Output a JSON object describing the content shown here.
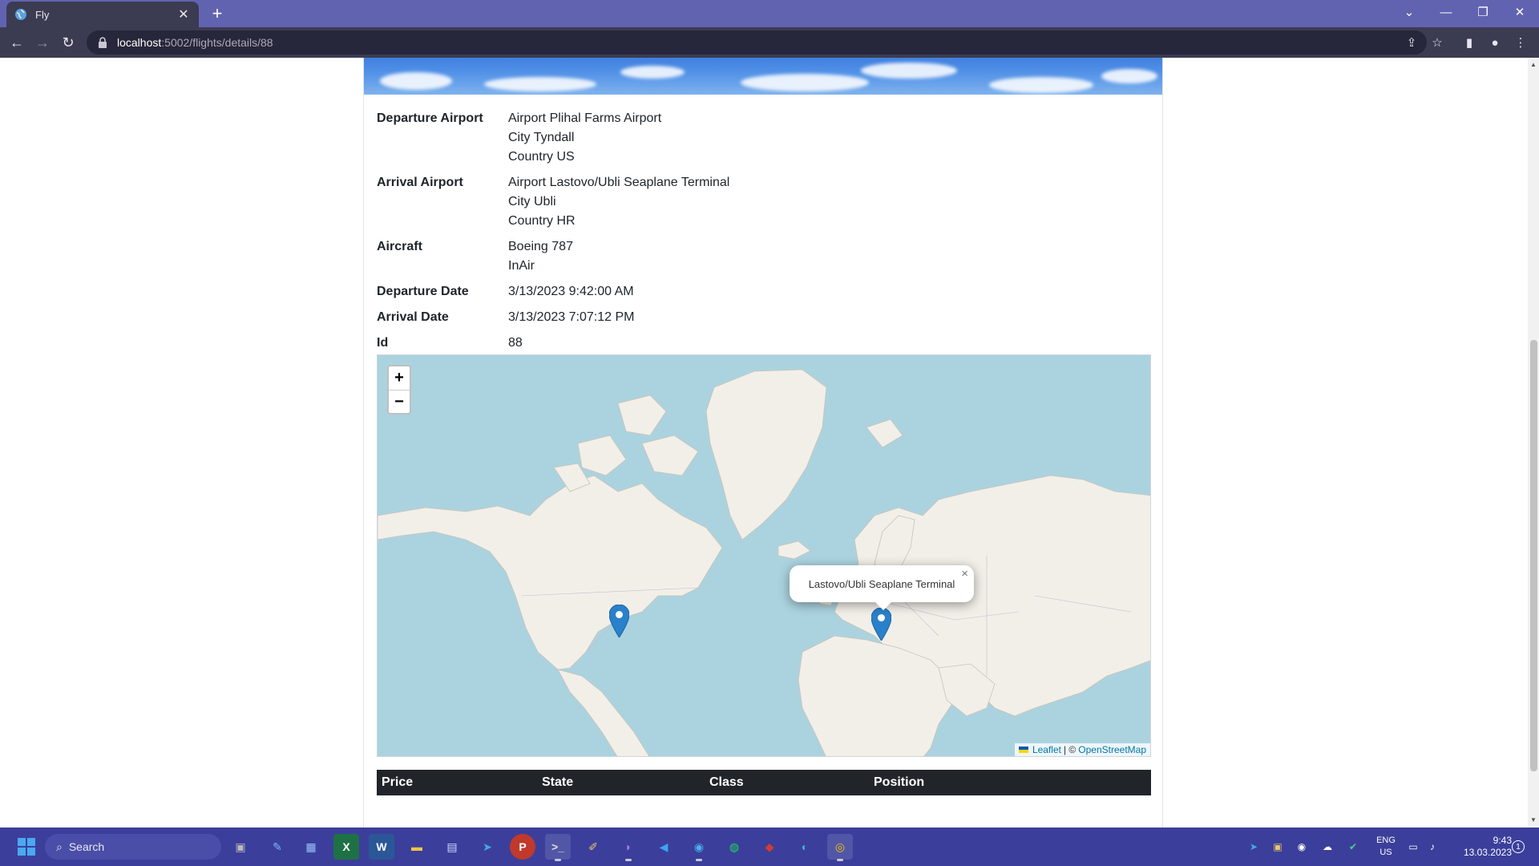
{
  "browser": {
    "tab_title": "Fly",
    "url_host": "localhost",
    "url_path": ":5002/flights/details/88"
  },
  "details": [
    {
      "label": "Departure Airport",
      "lines": [
        "Airport Plihal Farms Airport",
        "City Tyndall",
        "Country US"
      ]
    },
    {
      "label": "Arrival Airport",
      "lines": [
        "Airport Lastovo/Ubli Seaplane Terminal",
        "City Ubli",
        "Country HR"
      ]
    },
    {
      "label": "Aircraft",
      "lines": [
        "Boeing 787",
        "InAir"
      ]
    },
    {
      "label": "Departure Date",
      "lines": [
        "3/13/2023 9:42:00 AM"
      ]
    },
    {
      "label": "Arrival Date",
      "lines": [
        "3/13/2023 7:07:12 PM"
      ]
    },
    {
      "label": "Id",
      "lines": [
        "88"
      ]
    }
  ],
  "map": {
    "zoom_in": "+",
    "zoom_out": "−",
    "popup_text": "Lastovo/Ubli Seaplane Terminal",
    "popup_close": "×",
    "attribution_leaflet": "Leaflet",
    "attribution_sep": "| ©",
    "attribution_osm": "OpenStreetMap",
    "markers": [
      "departure",
      "arrival"
    ],
    "colors": {
      "water": "#abd3df",
      "land": "#f2efe9",
      "marker": "#2a81cb"
    }
  },
  "table": {
    "headers": [
      "Price",
      "State",
      "Class",
      "Position"
    ]
  },
  "taskbar": {
    "search_placeholder": "Search",
    "apps": [
      "task-view",
      "pen",
      "store",
      "excel",
      "word",
      "file-explorer",
      "calculator",
      "telegram",
      "postman",
      "terminal",
      "paint",
      "visual-studio",
      "vs-code",
      "docker",
      "spotify",
      "redis",
      "edge",
      "chrome"
    ],
    "lang_top": "ENG",
    "lang_bottom": "US",
    "time": "9:43",
    "date": "13.03.2023",
    "notification_count": "1"
  }
}
